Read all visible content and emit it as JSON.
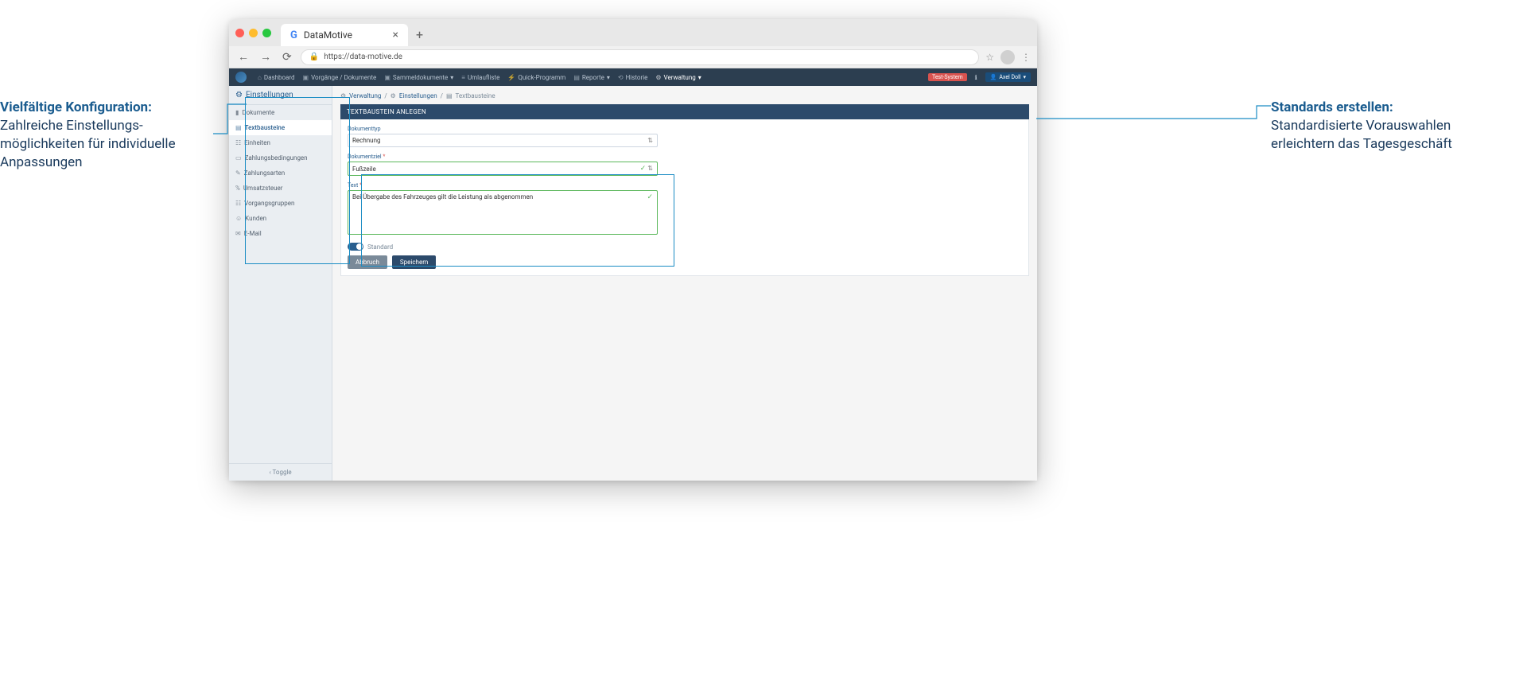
{
  "annotations": {
    "left_title": "Vielfältige Konfiguration:",
    "left_body": "Zahlreiche Einstellungs-möglichkeiten für individuelle Anpassungen",
    "right_title": "Standards erstellen:",
    "right_body": "Standardisierte Vorauswahlen erleichtern das Tagesgeschäft"
  },
  "browser": {
    "tab_title": "DataMotive",
    "url": "https://data-motive.de"
  },
  "nav": {
    "items": [
      "Dashboard",
      "Vorgänge / Dokumente",
      "Sammeldokumente",
      "Umlaufliste",
      "Quick-Programm",
      "Reporte",
      "Historie",
      "Verwaltung"
    ],
    "badge": "Test-System",
    "user": "Axel Doll"
  },
  "sidebar": {
    "title": "Einstellungen",
    "items": [
      "Dokumente",
      "Textbausteine",
      "Einheiten",
      "Zahlungsbedingungen",
      "Zahlungsarten",
      "Umsatzsteuer",
      "Vorgangsgruppen",
      "Kunden",
      "E-Mail"
    ],
    "toggle": "Toggle"
  },
  "breadcrumb": [
    "Verwaltung",
    "Einstellungen",
    "Textbausteine"
  ],
  "panel": {
    "title": "TEXTBAUSTEIN ANLEGEN",
    "dokumenttyp_label": "Dokumenttyp",
    "dokumenttyp_value": "Rechnung",
    "dokumentziel_label": "Dokumentziel",
    "dokumentziel_value": "Fußzeile",
    "text_label": "Text",
    "text_value": "Bei Übergabe des Fahrzeuges gilt die Leistung als abgenommen",
    "standard_label": "Standard",
    "cancel": "Abbruch",
    "save": "Speichern"
  }
}
